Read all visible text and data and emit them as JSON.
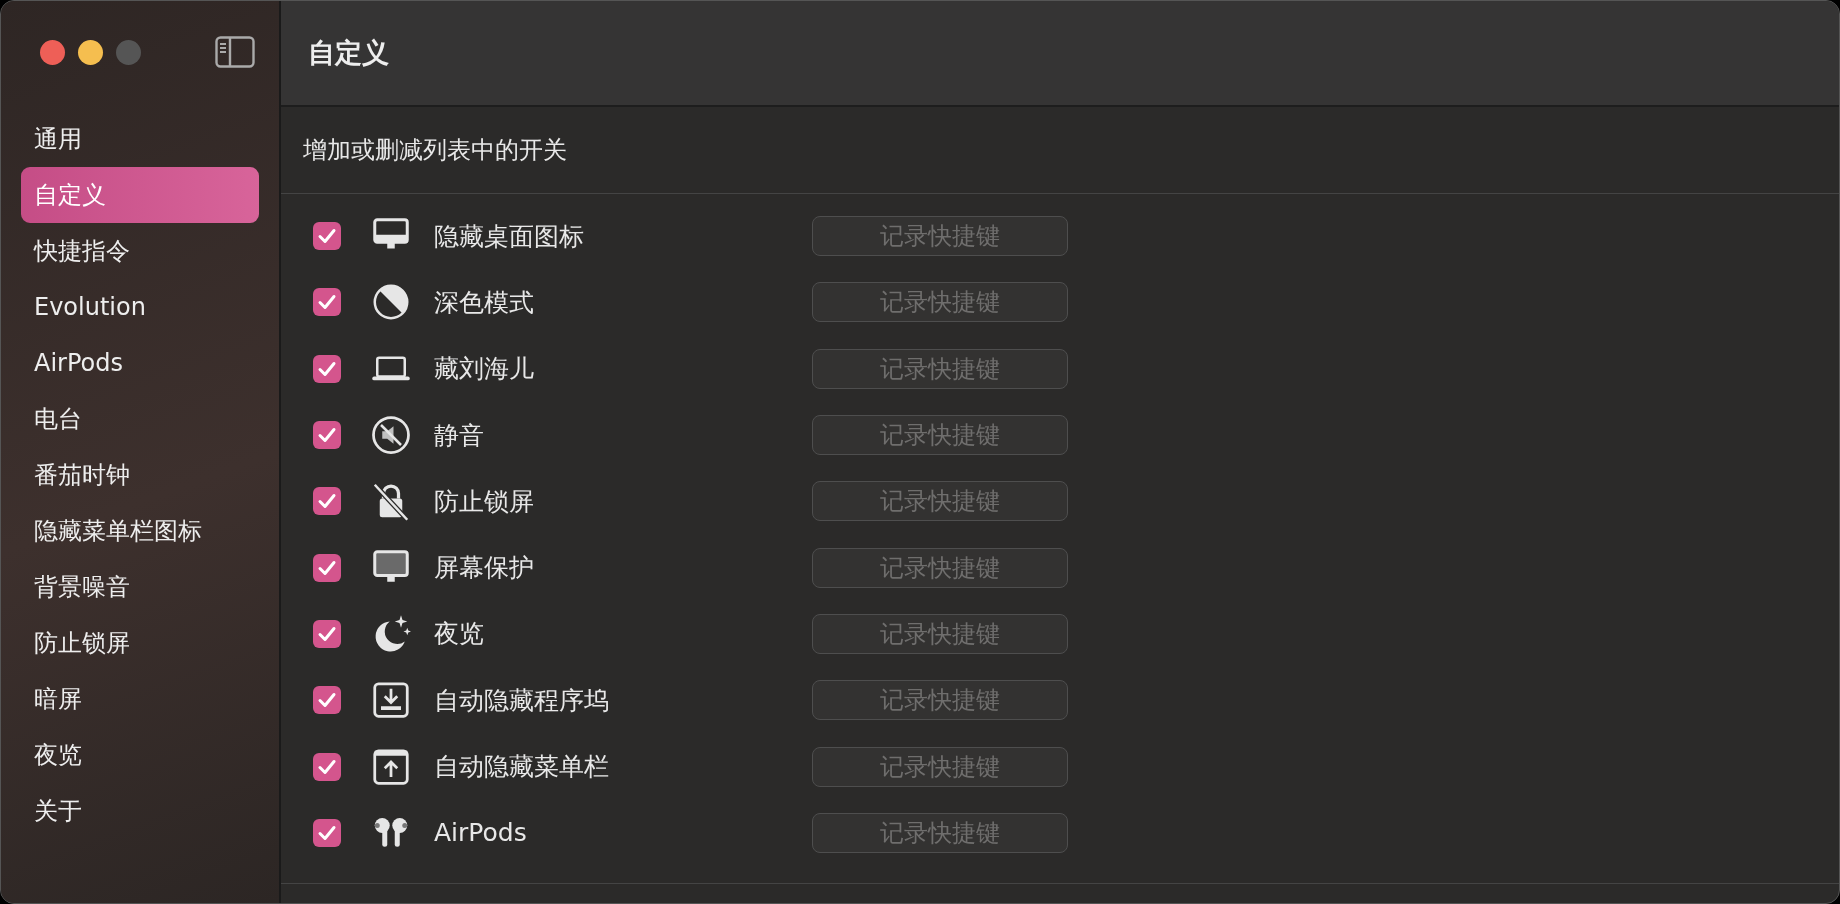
{
  "window": {
    "title": "自定义"
  },
  "sidebar": {
    "items": [
      {
        "label": "通用",
        "selected": false
      },
      {
        "label": "自定义",
        "selected": true
      },
      {
        "label": "快捷指令",
        "selected": false
      },
      {
        "label": "Evolution",
        "selected": false
      },
      {
        "label": "AirPods",
        "selected": false
      },
      {
        "label": "电台",
        "selected": false
      },
      {
        "label": "番茄时钟",
        "selected": false
      },
      {
        "label": "隐藏菜单栏图标",
        "selected": false
      },
      {
        "label": "背景噪音",
        "selected": false
      },
      {
        "label": "防止锁屏",
        "selected": false
      },
      {
        "label": "暗屏",
        "selected": false
      },
      {
        "label": "夜览",
        "selected": false
      },
      {
        "label": "关于",
        "selected": false
      }
    ]
  },
  "subtitle": "增加或删减列表中的开关",
  "switches": [
    {
      "label": "隐藏桌面图标",
      "checked": true,
      "button": "记录快捷键",
      "disabled": true
    },
    {
      "label": "深色模式",
      "checked": true,
      "button": "记录快捷键",
      "disabled": true
    },
    {
      "label": "藏刘海儿",
      "checked": true,
      "button": "记录快捷键",
      "disabled": true
    },
    {
      "label": "静音",
      "checked": true,
      "button": "记录快捷键",
      "disabled": true
    },
    {
      "label": "防止锁屏",
      "checked": true,
      "button": "记录快捷键",
      "disabled": true
    },
    {
      "label": "屏幕保护",
      "checked": true,
      "button": "记录快捷键",
      "disabled": true
    },
    {
      "label": "夜览",
      "checked": true,
      "button": "记录快捷键",
      "disabled": true
    },
    {
      "label": "自动隐藏程序坞",
      "checked": true,
      "button": "记录快捷键",
      "disabled": true
    },
    {
      "label": "自动隐藏菜单栏",
      "checked": true,
      "button": "记录快捷键",
      "disabled": true
    },
    {
      "label": "AirPods",
      "checked": true,
      "button": "记录快捷键",
      "disabled": true
    }
  ]
}
